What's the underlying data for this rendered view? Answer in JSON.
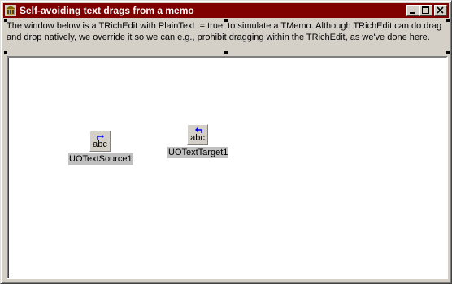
{
  "window": {
    "title": "Self-avoiding text drags from a memo",
    "description": "The window below is a TRichEdit with PlainText := true, to simulate a TMemo.  Although TRichEdit can do drag and drop natively, we override it so we can e.g., prohibit dragging within the TRichEdit, as we've done here."
  },
  "title_buttons": {
    "minimize_icon": "minimize-icon",
    "maximize_icon": "maximize-icon",
    "close_icon": "close-icon"
  },
  "components": [
    {
      "label": "UOTextSource1",
      "glyph": "abc",
      "icon": "drag-source-icon"
    },
    {
      "label": "UOTextTarget1",
      "glyph": "abc",
      "icon": "drag-target-icon"
    }
  ],
  "colors": {
    "titlebar": "#800000",
    "face": "#d4d0c8",
    "memo_background": "#ffffff",
    "arrow": "#0000ff"
  }
}
